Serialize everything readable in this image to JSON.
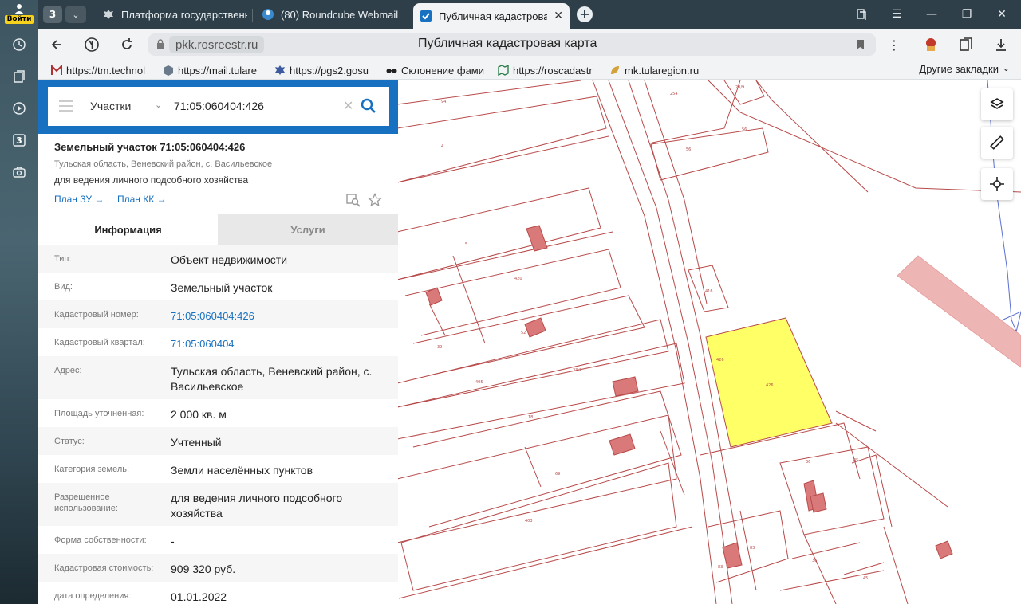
{
  "sidepanel": {
    "login_label": "Войти",
    "tab_count_badge": "3"
  },
  "tabs": {
    "count": "3",
    "items": [
      {
        "title": "Платформа государственных",
        "icon": "eagle-icon"
      },
      {
        "title": "(80) Roundcube Webmail",
        "icon": "roundcube-icon"
      },
      {
        "title": "Публичная кадастровая карта",
        "icon": "rosreestr-icon",
        "active": true
      }
    ]
  },
  "address": {
    "host": "pkk.rosreestr.ru",
    "page_title": "Публичная кадастровая карта"
  },
  "bookmarks": {
    "items": [
      {
        "label": "https://tm.technol",
        "icon": "m-icon"
      },
      {
        "label": "https://mail.tulare",
        "icon": "box-icon"
      },
      {
        "label": "https://pgs2.gosu",
        "icon": "eagle-icon"
      },
      {
        "label": "Склонение фами",
        "icon": "glasses-icon"
      },
      {
        "label": "https://roscadastr",
        "icon": "map-icon"
      },
      {
        "label": "mk.tularegion.ru",
        "icon": "leaf-icon"
      }
    ],
    "more": "Другие закладки"
  },
  "search": {
    "type": "Участки",
    "value": "71:05:060404:426"
  },
  "object": {
    "title": "Земельный участок 71:05:060404:426",
    "address": "Тульская область, Веневский район, с. Васильевское",
    "usage": "для ведения личного подсобного хозяйства",
    "link_plan_zu": "План ЗУ →",
    "link_plan_kk": "План КК →"
  },
  "panel_tabs": {
    "info": "Информация",
    "services": "Услуги"
  },
  "attributes": [
    {
      "key": "Тип:",
      "value": "Объект недвижимости"
    },
    {
      "key": "Вид:",
      "value": "Земельный участок"
    },
    {
      "key": "Кадастровый номер:",
      "value": "71:05:060404:426",
      "link": true
    },
    {
      "key": "Кадастровый квартал:",
      "value": "71:05:060404",
      "link": true
    },
    {
      "key": "Адрес:",
      "value": "Тульская область, Веневский район, с. Васильевское"
    },
    {
      "key": "Площадь уточненная:",
      "value": "2 000 кв. м"
    },
    {
      "key": "Статус:",
      "value": "Учтенный"
    },
    {
      "key": "Категория земель:",
      "value": "Земли населённых пунктов"
    },
    {
      "key": "Разрешенное использование:",
      "value": "для ведения личного подсобного хозяйства"
    },
    {
      "key": "Форма собственности:",
      "value": "-"
    },
    {
      "key": "Кадастровая стоимость:",
      "value": "909 320 руб."
    },
    {
      "key": "дата определения:",
      "value": "01.01.2022"
    }
  ],
  "map": {
    "parcel_line_color": "#b84a4a",
    "building_fill": "#d9797a",
    "selected_fill": "#ffff66",
    "zone_fill": "#eeb5b5",
    "labels": [
      "94",
      "4",
      "5",
      "420",
      "39",
      "405",
      "18",
      "69",
      "403",
      "23:2",
      "254",
      "56",
      "56",
      "416",
      "426",
      "426",
      "36",
      "45",
      "83",
      "36",
      "45",
      "83",
      "52",
      "23/9"
    ]
  }
}
